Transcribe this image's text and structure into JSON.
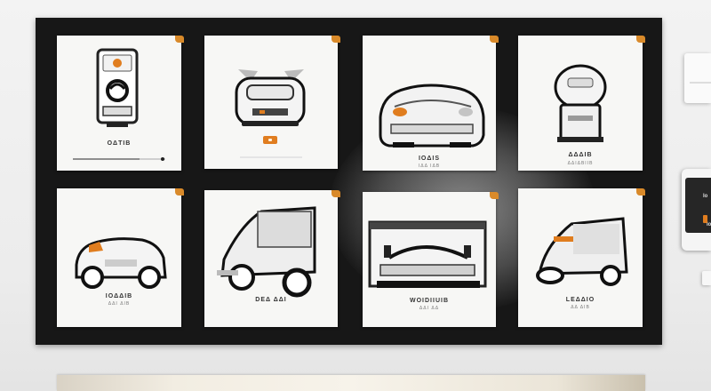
{
  "colors": {
    "board": "#171717",
    "accent": "#e07d1f",
    "card": "#f7f7f5"
  },
  "cards": [
    {
      "title": "OΔTIB",
      "sub": "",
      "icon": "smartphone-icon",
      "progress": 0.72,
      "has_badge": false
    },
    {
      "title": "",
      "sub": "",
      "icon": "robot-vacuum-icon",
      "progress": 0,
      "has_badge": true
    },
    {
      "title": "IOΔIS",
      "sub": "IΔΔ IΔB",
      "icon": "car-top-view-icon",
      "progress": 0,
      "has_badge": false
    },
    {
      "title": "ΔΔΔIB",
      "sub": "ΔΔIΔBIIB",
      "icon": "kiosk-icon",
      "progress": 0,
      "has_badge": false
    },
    {
      "title": "IOΔΔIB",
      "sub": "ΔΔI ΔIB",
      "icon": "compact-car-icon",
      "progress": 0,
      "has_badge": false
    },
    {
      "title": "DEΔ ΔΔI",
      "sub": "",
      "icon": "cargo-vehicle-icon",
      "progress": 0,
      "has_badge": false
    },
    {
      "title": "WOIDIIUIB",
      "sub": "ΔΔI ΔΔ",
      "icon": "car-front-view-icon",
      "progress": 0,
      "has_badge": false
    },
    {
      "title": "LEΔΔIO",
      "sub": "ΔΔ ΔIB",
      "icon": "scooter-car-icon",
      "progress": 0,
      "has_badge": false
    }
  ],
  "side_device": {
    "line1": "Io",
    "line2": "Io"
  }
}
